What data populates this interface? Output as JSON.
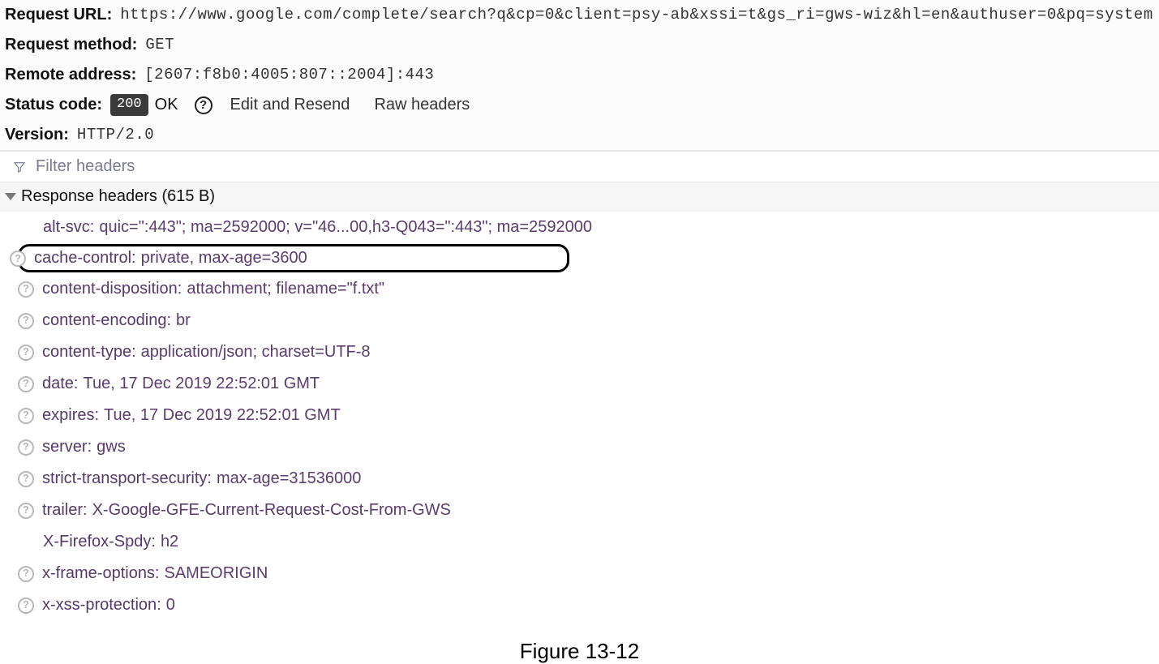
{
  "request": {
    "url_label": "Request URL:",
    "url_value": "https://www.google.com/complete/search?q&cp=0&client=psy-ab&xssi=t&gs_ri=gws-wiz&hl=en&authuser=0&pq=system design interview&",
    "method_label": "Request method:",
    "method_value": "GET",
    "remote_label": "Remote address:",
    "remote_value": "[2607:f8b0:4005:807::2004]:443",
    "status_label": "Status code:",
    "status_code": "200",
    "status_text": "OK",
    "edit_resend": "Edit and Resend",
    "raw_headers": "Raw headers",
    "version_label": "Version:",
    "version_value": "HTTP/2.0"
  },
  "filter": {
    "placeholder": "Filter headers"
  },
  "section": {
    "title": "Response headers (615 B)"
  },
  "headers": [
    {
      "name": "alt-svc:",
      "value": "quic=\":443\"; ma=2592000; v=\"46...00,h3-Q043=\":443\"; ma=2592000",
      "help": false,
      "highlight": false
    },
    {
      "name": "cache-control:",
      "value": "private, max-age=3600",
      "help": true,
      "highlight": true
    },
    {
      "name": "content-disposition:",
      "value": "attachment; filename=\"f.txt\"",
      "help": true,
      "highlight": false
    },
    {
      "name": "content-encoding:",
      "value": "br",
      "help": true,
      "highlight": false
    },
    {
      "name": "content-type:",
      "value": "application/json; charset=UTF-8",
      "help": true,
      "highlight": false
    },
    {
      "name": "date:",
      "value": "Tue, 17 Dec 2019 22:52:01 GMT",
      "help": true,
      "highlight": false
    },
    {
      "name": "expires:",
      "value": "Tue, 17 Dec 2019 22:52:01 GMT",
      "help": true,
      "highlight": false
    },
    {
      "name": "server:",
      "value": "gws",
      "help": true,
      "highlight": false
    },
    {
      "name": "strict-transport-security:",
      "value": "max-age=31536000",
      "help": true,
      "highlight": false
    },
    {
      "name": "trailer:",
      "value": "X-Google-GFE-Current-Request-Cost-From-GWS",
      "help": true,
      "highlight": false
    },
    {
      "name": "X-Firefox-Spdy:",
      "value": "h2",
      "help": false,
      "highlight": false
    },
    {
      "name": "x-frame-options:",
      "value": "SAMEORIGIN",
      "help": true,
      "highlight": false
    },
    {
      "name": "x-xss-protection:",
      "value": "0",
      "help": true,
      "highlight": false
    }
  ],
  "caption": "Figure 13-12"
}
